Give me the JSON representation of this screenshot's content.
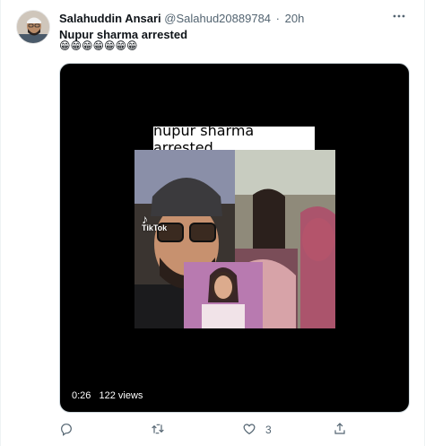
{
  "tweet": {
    "display_name": "Salahuddin Ansari",
    "handle": "@Salahud20889784",
    "separator": "·",
    "time": "20h",
    "text": "Nupur sharma arrested",
    "emojis": "😁😁😁😁😁😁😁",
    "more_icon": "more-horizontal-icon"
  },
  "media": {
    "caption": "nupur sharma arrested",
    "watermark": "TikTok",
    "duration": "0:26",
    "views": "122 views"
  },
  "actions": {
    "reply": {
      "icon": "reply-icon",
      "count": ""
    },
    "retweet": {
      "icon": "retweet-icon",
      "count": ""
    },
    "like": {
      "icon": "heart-icon",
      "count": "3"
    },
    "share": {
      "icon": "share-icon",
      "count": ""
    }
  },
  "colors": {
    "text_primary": "#0f1419",
    "text_secondary": "#536471",
    "media_bg": "#000000",
    "border": "#cfd9de"
  }
}
